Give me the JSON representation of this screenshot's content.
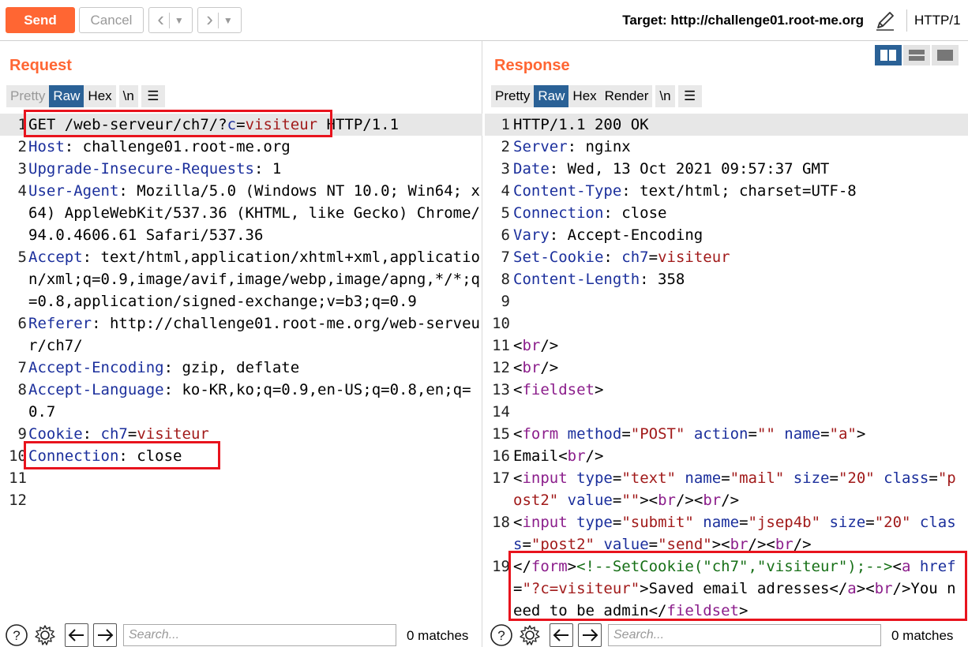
{
  "toolbar": {
    "send": "Send",
    "cancel": "Cancel",
    "target": "Target: http://challenge01.root-me.org",
    "http_version": "HTTP/1",
    "icons": {
      "back": "chevron-left-icon",
      "forward": "chevron-right-icon",
      "edit": "pencil-icon"
    }
  },
  "request": {
    "title": "Request",
    "tabs": [
      "Pretty",
      "Raw",
      "Hex",
      "\\n"
    ],
    "active_tab": "Raw",
    "lines": [
      {
        "n": "1",
        "key": "GET /web-serveur/ch7/?",
        "p1": "c",
        "p2": "=",
        "p3": "visiteur",
        "rest": " HTTP/1.1"
      },
      {
        "n": "2",
        "key": "Host",
        "rest": ": challenge01.root-me.org"
      },
      {
        "n": "3",
        "key": "Upgrade-Insecure-Requests",
        "rest": ": 1"
      },
      {
        "n": "4",
        "key": "User-Agent",
        "rest": ": Mozilla/5.0 (Windows NT 10.0; Win64; x64) AppleWebKit/537.36 (KHTML, like Gecko) Chrome/94.0.4606.61 Safari/537.36"
      },
      {
        "n": "5",
        "key": "Accept",
        "rest": ": text/html,application/xhtml+xml,application/xml;q=0.9,image/avif,image/webp,image/apng,*/*;q=0.8,application/signed-exchange;v=b3;q=0.9"
      },
      {
        "n": "6",
        "key": "Referer",
        "rest": ": http://challenge01.root-me.org/web-serveur/ch7/"
      },
      {
        "n": "7",
        "key": "Accept-Encoding",
        "rest": ": gzip, deflate"
      },
      {
        "n": "8",
        "key": "Accept-Language",
        "rest": ": ko-KR,ko;q=0.9,en-US;q=0.8,en;q=0.7"
      },
      {
        "n": "9",
        "key": "Cookie",
        "p0": ": ",
        "p1": "ch7",
        "p2": "=",
        "p3": "visiteur"
      },
      {
        "n": "10",
        "key": "Connection",
        "rest": ": close"
      },
      {
        "n": "11",
        "rest": ""
      },
      {
        "n": "12",
        "rest": ""
      }
    ],
    "search_placeholder": "Search...",
    "matches": "0 matches"
  },
  "response": {
    "title": "Response",
    "tabs": [
      "Pretty",
      "Raw",
      "Hex",
      "Render",
      "\\n"
    ],
    "active_tab": "Raw",
    "headers": [
      {
        "n": "1",
        "plain": "HTTP/1.1 200 OK"
      },
      {
        "n": "2",
        "key": "Server",
        "rest": ": nginx"
      },
      {
        "n": "3",
        "key": "Date",
        "rest": ": Wed, 13 Oct 2021 09:57:37 GMT"
      },
      {
        "n": "4",
        "key": "Content-Type",
        "rest": ": text/html; charset=UTF-8"
      },
      {
        "n": "5",
        "key": "Connection",
        "rest": ": close"
      },
      {
        "n": "6",
        "key": "Vary",
        "rest": ": Accept-Encoding"
      },
      {
        "n": "7",
        "key": "Set-Cookie",
        "p0": ": ",
        "p1": "ch7",
        "p2": "=",
        "p3": "visiteur"
      },
      {
        "n": "8",
        "key": "Content-Length",
        "rest": ": 358"
      }
    ],
    "body_numbers": [
      "9",
      "10",
      "11",
      "12",
      "13",
      "14",
      "15",
      "16",
      "17",
      "18",
      "19"
    ],
    "body_strings": {
      "br": "br",
      "fieldset": "fieldset",
      "form": "form",
      "method": "method",
      "post": "\"POST\"",
      "action": "action",
      "empty": "\"\"",
      "name": "name",
      "a_val": "\"a\"",
      "email": "Email",
      "input": "input",
      "type": "type",
      "text_val": "\"text\"",
      "mail_val": "\"mail\"",
      "size": "size",
      "twenty": "\"20\"",
      "class": "class",
      "post2": "\"post2\"",
      "value": "value",
      "submit_val": "\"submit\"",
      "jsep_val": "\"jsep4b\"",
      "send_val": "\"send\"",
      "comment": "<!--SetCookie(\"ch7\",\"visiteur\");-->",
      "a": "a",
      "href": "href",
      "href_val": "\"?c=visiteur\"",
      "saved": "Saved email adresses",
      "admin": "You need to be admin"
    },
    "search_placeholder": "Search...",
    "matches": "0 matches"
  },
  "colors": {
    "accent": "#ff6633",
    "tab_active": "#2a6196",
    "highlight_box": "#e8131d"
  }
}
